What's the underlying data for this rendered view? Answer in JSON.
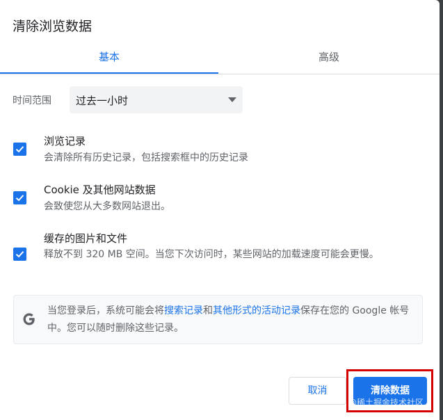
{
  "dialog": {
    "title": "清除浏览数据",
    "tabs": [
      {
        "label": "基本",
        "active": true
      },
      {
        "label": "高级",
        "active": false
      }
    ],
    "time_range": {
      "label": "时间范围",
      "selected": "过去一小时"
    },
    "options": [
      {
        "title": "浏览记录",
        "description": "会清除所有历史记录，包括搜索框中的历史记录",
        "checked": true
      },
      {
        "title": "Cookie 及其他网站数据",
        "description": "会致使您从大多数网站退出。",
        "checked": true
      },
      {
        "title": "缓存的图片和文件",
        "description": "释放不到 320 MB 空间。当您下次访问时，某些网站的加载速度可能会更慢。",
        "checked": true
      }
    ],
    "info": {
      "icon": "google-g-icon",
      "text_before": "当您登录后，系统可能会将",
      "link1": "搜索记录",
      "text_middle": "和",
      "link2": "其他形式的活动记录",
      "text_after": "保存在您的 Google 帐号中。您可以随时删除这些记录。"
    },
    "buttons": {
      "cancel": "取消",
      "clear": "清除数据"
    }
  },
  "watermark": "@稀土掘金技术社区",
  "colors": {
    "accent": "#1a73e8",
    "highlight": "#d50000"
  }
}
